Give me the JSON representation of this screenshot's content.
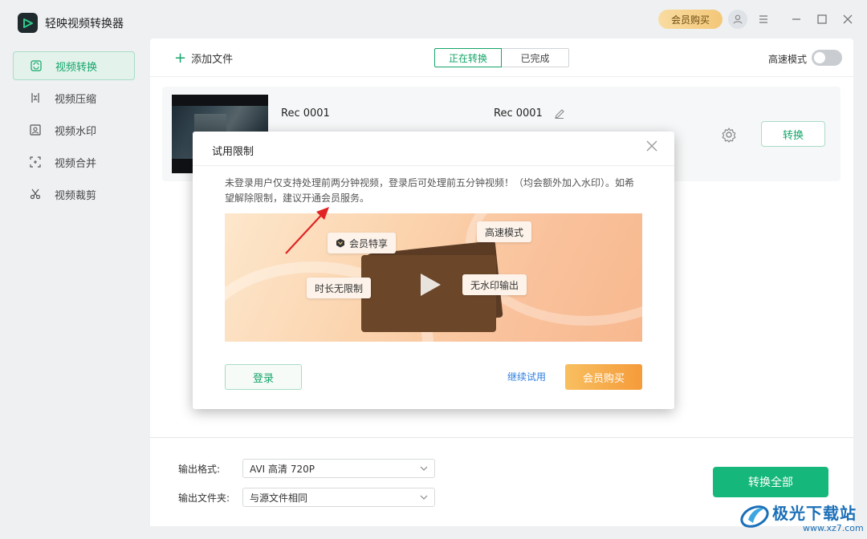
{
  "app": {
    "title": "轻映视频转换器"
  },
  "titlebar": {
    "vip_label": "会员购买"
  },
  "sidebar": {
    "items": [
      {
        "label": "视频转换",
        "icon": "convert-icon"
      },
      {
        "label": "视频压缩",
        "icon": "compress-icon"
      },
      {
        "label": "视频水印",
        "icon": "watermark-icon"
      },
      {
        "label": "视频合并",
        "icon": "merge-icon"
      },
      {
        "label": "视频裁剪",
        "icon": "scissors-icon"
      }
    ]
  },
  "toolbar": {
    "add_file": "添加文件",
    "tabs": [
      {
        "label": "正在转换"
      },
      {
        "label": "已完成"
      }
    ],
    "speed_mode": "高速模式"
  },
  "file": {
    "source_name": "Rec 0001",
    "output_name": "Rec 0001",
    "convert_label": "转换"
  },
  "output": {
    "format_label": "输出格式:",
    "format_value": "AVI 高清 720P",
    "folder_label": "输出文件夹:",
    "folder_value": "与源文件相同",
    "convert_all": "转换全部"
  },
  "dialog": {
    "title": "试用限制",
    "message": "未登录用户仅支持处理前两分钟视频，登录后可处理前五分钟视频！（均会额外加入水印）。如希望解除限制，建议开通会员服务。",
    "chips": {
      "vip": "会员特享",
      "speed": "高速模式",
      "unlimited": "时长无限制",
      "no_watermark": "无水印输出"
    },
    "login": "登录",
    "continue_trial": "继续试用",
    "buy": "会员购买"
  },
  "watermark": {
    "brand": "极光下载站",
    "url": "www.xz7.com"
  },
  "colors": {
    "accent": "#14a56a",
    "primary_button": "#15b77a",
    "vip_gold": "#f3c779",
    "buy_orange": "#f59b3a",
    "link": "#2f7ee0"
  }
}
